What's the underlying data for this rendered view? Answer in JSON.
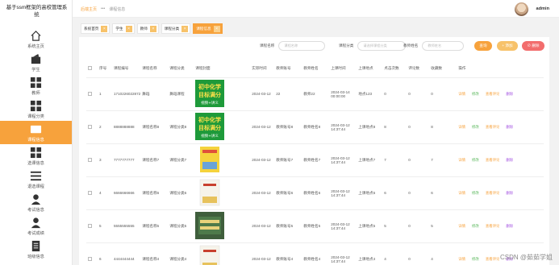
{
  "app": {
    "title": "基于ssm框架的高校管理系统"
  },
  "sidebar": {
    "items": [
      {
        "label": "系统主页",
        "icon": "home-icon"
      },
      {
        "label": "学生",
        "icon": "user-card-icon"
      },
      {
        "label": "教师",
        "icon": "grid-icon"
      },
      {
        "label": "课程分类",
        "icon": "grid-icon"
      },
      {
        "label": "课程信息",
        "icon": "folder-icon",
        "active": true
      },
      {
        "label": "选课信息",
        "icon": "grid-icon"
      },
      {
        "label": "退选课程",
        "icon": "list-icon"
      },
      {
        "label": "考试信息",
        "icon": "person-icon"
      },
      {
        "label": "考试成绩",
        "icon": "person-icon"
      },
      {
        "label": "班级信息",
        "icon": "doc-icon"
      }
    ]
  },
  "header": {
    "breadcrumb_home": "后端主页",
    "breadcrumb_sep": "•••",
    "breadcrumb_current": "课程信息",
    "username": "admin"
  },
  "tabs": [
    {
      "label": "系统首页",
      "close": "×"
    },
    {
      "label": "学生",
      "close": "×"
    },
    {
      "label": "教师",
      "close": "×"
    },
    {
      "label": "课程分类",
      "close": "×"
    },
    {
      "label": "课程信息",
      "close": "×",
      "active": true
    }
  ],
  "search": {
    "name_label": "课程名称",
    "name_placeholder": "课程名称",
    "category_label": "课程分类",
    "category_placeholder": "请选择课程分类",
    "location_label": "教师姓名",
    "location_placeholder": "教师姓名",
    "query_button": "查询",
    "add_button": "+ 添加",
    "delete_button": "⊘ 删除"
  },
  "colors": {
    "accent": "#f7a23c",
    "edit": "#5bb85d",
    "delete": "#a24fe0",
    "danger": "#f26d6d"
  },
  "table": {
    "headers": [
      "",
      "序号",
      "课程编号",
      "课程名称",
      "课程分类",
      "课程封面",
      "实际时间",
      "教师账号",
      "教师姓名",
      "上课时间",
      "上课地点",
      "点击次数",
      "评论数",
      "收藏数",
      "操作"
    ],
    "actions": [
      "详情",
      "修改",
      "查看评论",
      "删除"
    ],
    "rows": [
      {
        "seq": "1",
        "code": "1710226022872",
        "name": "舞蹈",
        "category": "舞蹈课程",
        "cover": "banner",
        "date": "2024-03-12",
        "teacher_id": "22",
        "teacher_name": "教师22",
        "time": "2024-03-14 00:00:00",
        "place": "地点123",
        "clicks": "0",
        "comments": "0",
        "favs": "0"
      },
      {
        "seq": "2",
        "code": "8888888888",
        "name": "课程名称8",
        "category": "课程分类8",
        "cover": "banner",
        "date": "2024-03-12",
        "teacher_id": "教师账号8",
        "teacher_name": "教师姓名8",
        "time": "2024-03-12 14:37:44",
        "place": "上课地点8",
        "clicks": "8",
        "comments": "0",
        "favs": "8"
      },
      {
        "seq": "3",
        "code": "7777777777",
        "name": "课程名称7",
        "category": "课程分类7",
        "cover": "book-yellow",
        "date": "2024-03-12",
        "teacher_id": "教师账号7",
        "teacher_name": "教师姓名7",
        "time": "2024-03-12 14:37:44",
        "place": "上课地点7",
        "clicks": "7",
        "comments": "0",
        "favs": "7"
      },
      {
        "seq": "4",
        "code": "6666666666",
        "name": "课程名称6",
        "category": "课程分类6",
        "cover": "book-white",
        "date": "2024-03-12",
        "teacher_id": "教师账号6",
        "teacher_name": "教师姓名6",
        "time": "2024-03-12 14:37:44",
        "place": "上课地点6",
        "clicks": "6",
        "comments": "0",
        "favs": "6"
      },
      {
        "seq": "5",
        "code": "5555555555",
        "name": "课程名称5",
        "category": "课程分类5",
        "cover": "chalk",
        "date": "2024-03-12",
        "teacher_id": "教师账号5",
        "teacher_name": "教师姓名5",
        "time": "2024-03-12 14:37:44",
        "place": "上课地点5",
        "clicks": "5",
        "comments": "0",
        "favs": "5"
      },
      {
        "seq": "6",
        "code": "4444444444",
        "name": "课程名称4",
        "category": "课程分类4",
        "cover": "book-white",
        "date": "2024-03-12",
        "teacher_id": "教师账号4",
        "teacher_name": "教师姓名4",
        "time": "2024-03-12 14:37:44",
        "place": "上课地点4",
        "clicks": "4",
        "comments": "0",
        "favs": "4"
      }
    ],
    "cover_text": {
      "line1": "初中化学",
      "line2": "目标满分",
      "line3": "视频+讲义"
    }
  },
  "watermark": "CSDN @茹茹学姐"
}
